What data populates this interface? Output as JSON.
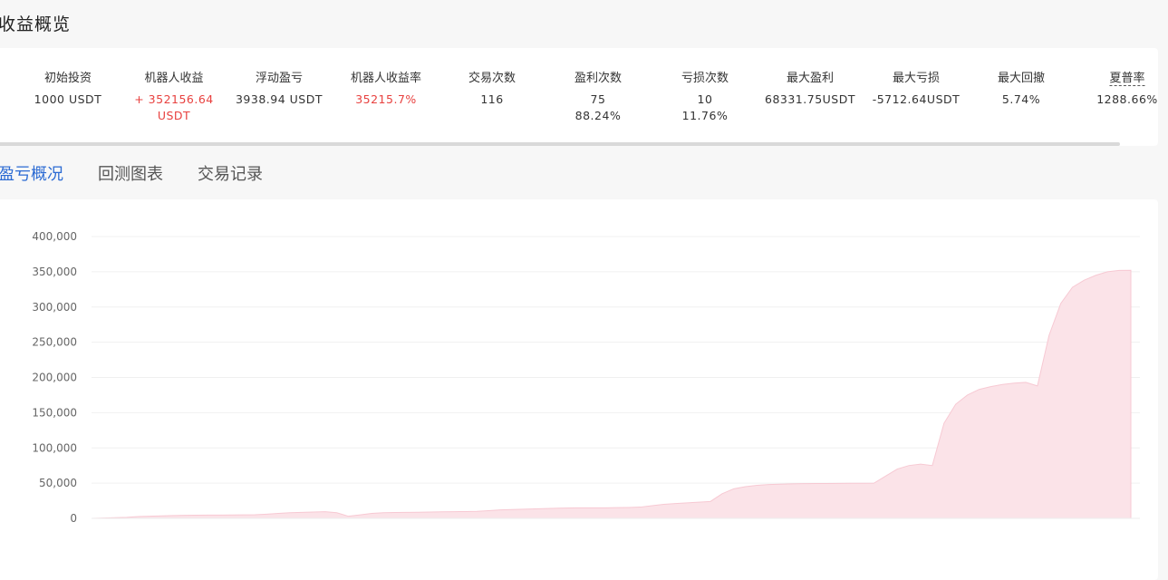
{
  "header": {
    "title": "收益概览"
  },
  "stats": [
    {
      "label": "初始投资",
      "lines": [
        "1000 USDT"
      ],
      "color": "default"
    },
    {
      "label": "机器人收益",
      "lines": [
        "+ 352156.64",
        "USDT"
      ],
      "color": "red"
    },
    {
      "label": "浮动盈亏",
      "lines": [
        "3938.94 USDT"
      ],
      "color": "default"
    },
    {
      "label": "机器人收益率",
      "lines": [
        "35215.7%"
      ],
      "color": "red"
    },
    {
      "label": "交易次数",
      "lines": [
        "116"
      ],
      "color": "default"
    },
    {
      "label": "盈利次数",
      "lines": [
        "75",
        "88.24%"
      ],
      "color": "default"
    },
    {
      "label": "亏损次数",
      "lines": [
        "10",
        "11.76%"
      ],
      "color": "default"
    },
    {
      "label": "最大盈利",
      "lines": [
        "68331.75USDT"
      ],
      "color": "default"
    },
    {
      "label": "最大亏损",
      "lines": [
        "-5712.64USDT"
      ],
      "color": "default"
    },
    {
      "label": "最大回撤",
      "lines": [
        "5.74%"
      ],
      "color": "default"
    },
    {
      "label": "夏普率",
      "lines": [
        "1288.66%"
      ],
      "color": "default"
    }
  ],
  "tabs": [
    {
      "label": "盈亏概况",
      "active": true
    },
    {
      "label": "回测图表",
      "active": false
    },
    {
      "label": "交易记录",
      "active": false
    }
  ],
  "colors": {
    "accent": "#2c6bd3",
    "positive": "#e8413f",
    "area_fill": "#fbe3e8",
    "area_line": "#f7c9d3"
  },
  "chart_data": {
    "type": "area",
    "title": "",
    "xlabel": "",
    "ylabel": "",
    "ylim": [
      0,
      400000
    ],
    "yticks": [
      0,
      50000,
      100000,
      150000,
      200000,
      250000,
      300000,
      350000,
      400000
    ],
    "ytick_labels": [
      "0",
      "50,000",
      "100,000",
      "150,000",
      "200,000",
      "250,000",
      "300,000",
      "350,000",
      "400,000"
    ],
    "grid": true,
    "series": [
      {
        "values": [
          0,
          500,
          1000,
          1500,
          2500,
          3000,
          3500,
          4000,
          4300,
          4500,
          4600,
          4700,
          4800,
          5000,
          5200,
          6000,
          7000,
          8000,
          8500,
          9000,
          9500,
          8000,
          3000,
          5000,
          7000,
          8000,
          8300,
          8500,
          8700,
          9000,
          9300,
          9500,
          9700,
          10000,
          11000,
          12000,
          12500,
          13000,
          13500,
          14000,
          14500,
          14800,
          15000,
          15000,
          15000,
          15200,
          15500,
          16000,
          18000,
          20000,
          21000,
          22000,
          23000,
          24000,
          35000,
          42000,
          45000,
          47000,
          48000,
          48500,
          49000,
          49300,
          49500,
          49600,
          49700,
          49800,
          49900,
          50000,
          60000,
          70000,
          75000,
          77000,
          75000,
          135000,
          162000,
          175000,
          183000,
          187000,
          190000,
          192000,
          193000,
          188000,
          260000,
          305000,
          328000,
          338000,
          345000,
          350000,
          352000,
          352156.64
        ]
      }
    ]
  }
}
